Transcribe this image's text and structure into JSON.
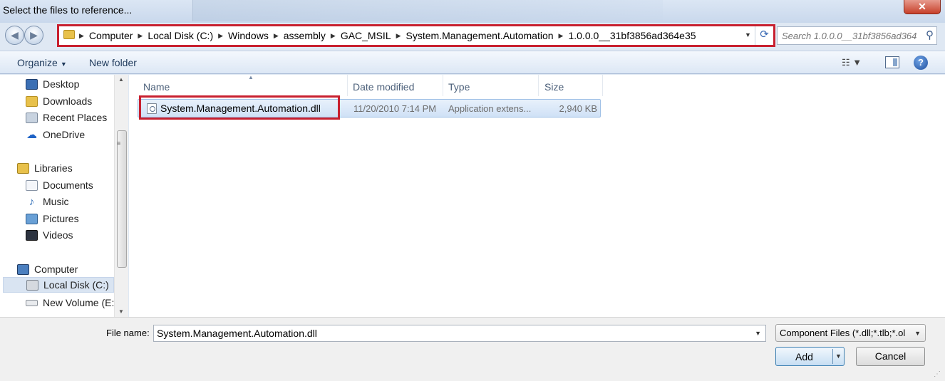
{
  "window": {
    "title": "Select the files to reference...",
    "close_glyph": "✕"
  },
  "navigation": {
    "back_glyph": "◀",
    "forward_glyph": "▶",
    "breadcrumb": [
      "Computer",
      "Local Disk (C:)",
      "Windows",
      "assembly",
      "GAC_MSIL",
      "System.Management.Automation",
      "1.0.0.0__31bf3856ad364e35"
    ],
    "separator": "▶",
    "dropdown_glyph": "▼",
    "refresh_glyph": "⟳",
    "search_placeholder": "Search 1.0.0.0__31bf3856ad364...",
    "search_icon_glyph": "⚲"
  },
  "toolbar": {
    "organize_label": "Organize",
    "organize_caret": "▼",
    "new_folder_label": "New folder",
    "view_glyph": "☷ ▼",
    "help_glyph": "?"
  },
  "sidebar": {
    "items": [
      {
        "label": "Desktop",
        "icon": "desktop-icon"
      },
      {
        "label": "Downloads",
        "icon": "downloads-icon"
      },
      {
        "label": "Recent Places",
        "icon": "recent-places-icon"
      },
      {
        "label": "OneDrive",
        "icon": "onedrive-icon",
        "glyph": "☁"
      },
      {
        "label": "Libraries",
        "icon": "libraries-icon"
      },
      {
        "label": "Documents",
        "icon": "documents-icon"
      },
      {
        "label": "Music",
        "icon": "music-icon",
        "glyph": "♪"
      },
      {
        "label": "Pictures",
        "icon": "pictures-icon"
      },
      {
        "label": "Videos",
        "icon": "videos-icon"
      },
      {
        "label": "Computer",
        "icon": "computer-icon"
      },
      {
        "label": "Local Disk (C:)",
        "icon": "local-disk-icon",
        "selected": true
      },
      {
        "label": "New Volume (E:)",
        "icon": "volume-icon"
      }
    ],
    "scroll_up_glyph": "▲",
    "scroll_down_glyph": "▼",
    "scroll_grip_glyph": "≡"
  },
  "file_list": {
    "columns": [
      "Name",
      "Date modified",
      "Type",
      "Size"
    ],
    "sort_glyph": "▲",
    "rows": [
      {
        "name": "System.Management.Automation.dll",
        "date_modified": "11/20/2010 7:14 PM",
        "type": "Application extens...",
        "size": "2,940 KB",
        "selected": true
      }
    ]
  },
  "footer": {
    "file_name_label": "File name:",
    "file_name_value": "System.Management.Automation.dll",
    "file_name_dd_glyph": "▼",
    "filter_value": "Component Files (*.dll;*.tlb;*.ol",
    "filter_dd_glyph": "▼",
    "add_label": "Add",
    "add_dd_glyph": "▼",
    "cancel_label": "Cancel",
    "resize_grip_glyph": "⋰"
  },
  "colors": {
    "highlight_box": "#c8202f",
    "selected_row": "#cfe1f6",
    "window_frame": "#dfe8f3"
  }
}
